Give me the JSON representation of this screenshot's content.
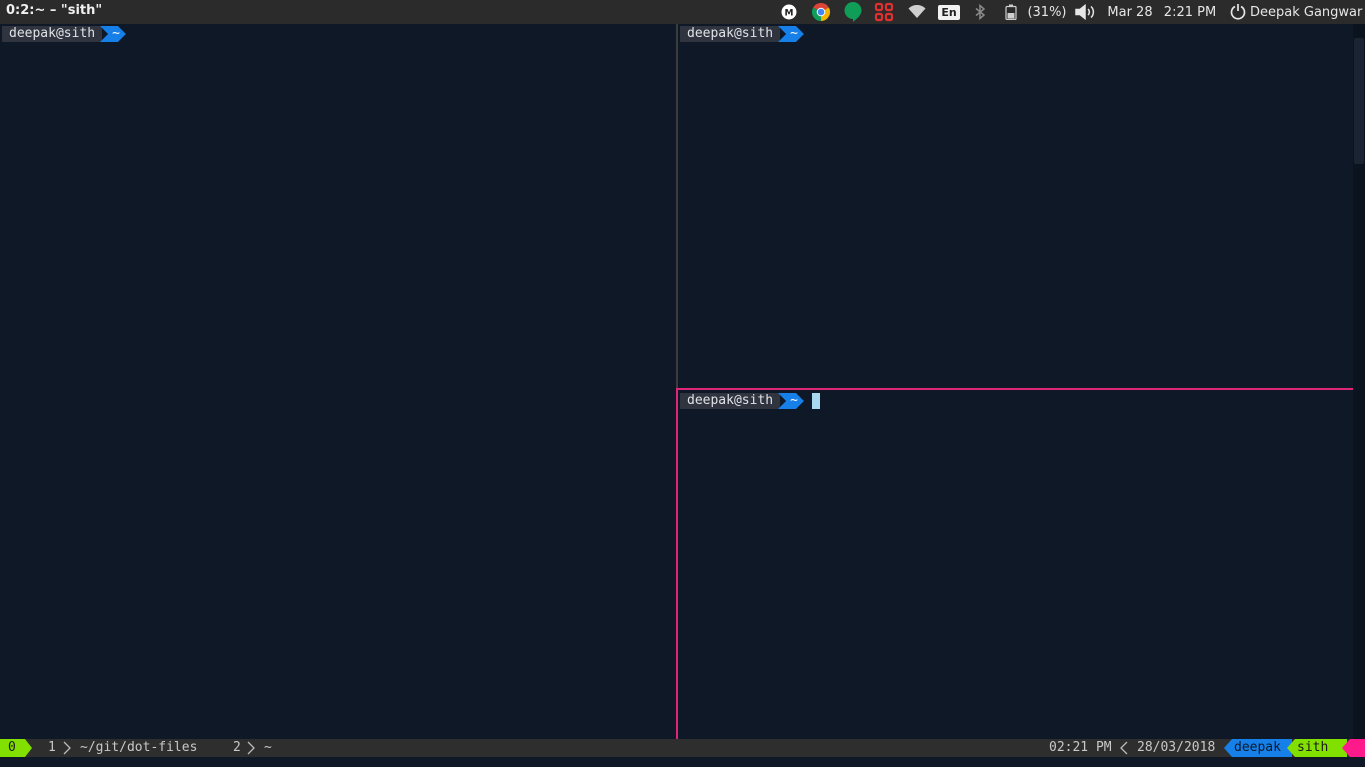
{
  "window": {
    "title": "0:2:~ – \"sith\""
  },
  "panel": {
    "tray_icons": [
      "m-icon",
      "chrome-icon",
      "hangouts-icon",
      "app-grid-icon",
      "wifi-icon",
      "en-keyboard-icon",
      "bluetooth-icon",
      "battery-icon",
      "volume-icon"
    ],
    "keyboard_layout": "En",
    "battery": "(31%)",
    "date": "Mar 28",
    "time": "2:21 PM",
    "user_name": "Deepak Gangwar"
  },
  "panes": {
    "left": {
      "user": "deepak@sith",
      "dir": "~"
    },
    "top_right": {
      "user": "deepak@sith",
      "dir": "~"
    },
    "bottom_right": {
      "user": "deepak@sith",
      "dir": "~"
    }
  },
  "status": {
    "session": "0",
    "windows": [
      {
        "index": "1",
        "path": "~/git/dot-files"
      },
      {
        "index": "2",
        "path": "~"
      }
    ],
    "time": "02:21 PM",
    "date": "28/03/2018",
    "user": "deepak",
    "host": "sith"
  },
  "colors": {
    "terminal_bg": "#0e1826",
    "active_pane_border": "#e0247a",
    "prompt_dir_bg": "#1680e8",
    "status_accent_green": "#82e000",
    "status_accent_pink": "#ff1a8c"
  }
}
